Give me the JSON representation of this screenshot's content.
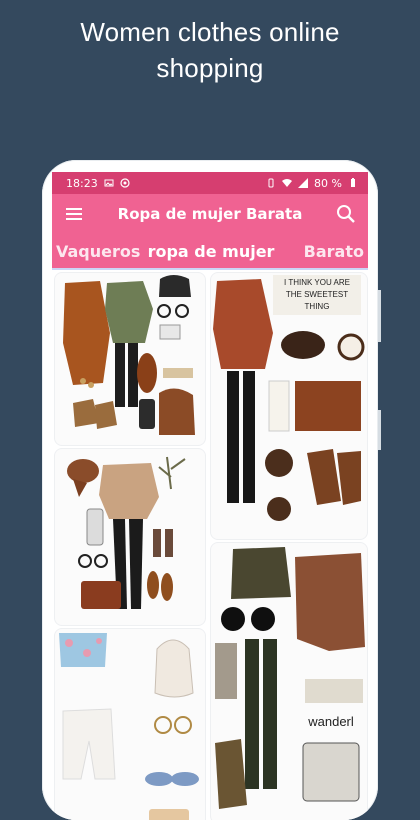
{
  "promo": {
    "headline_line1": "Women clothes online",
    "headline_line2": "shopping"
  },
  "status_bar": {
    "time": "18:23",
    "battery": "80 %"
  },
  "app_bar": {
    "title": "Ropa de mujer Barata",
    "menu_icon": "hamburger-menu-icon",
    "search_icon": "search-icon"
  },
  "tabs": [
    {
      "label": "Vaqueros"
    },
    {
      "label": "ropa de mujer"
    },
    {
      "label": "Barato"
    }
  ],
  "cards": [
    {
      "overlay_text": ""
    },
    {
      "overlay_text": ""
    },
    {
      "overlay_text": ""
    },
    {
      "overlay_text": "I THINK YOU ARE THE SWEETEST THING"
    },
    {
      "overlay_text": "wanderl"
    }
  ],
  "colors": {
    "background": "#34495e",
    "status_bar": "#d63e70",
    "app_bar": "#f06292",
    "text": "#ffffff"
  }
}
